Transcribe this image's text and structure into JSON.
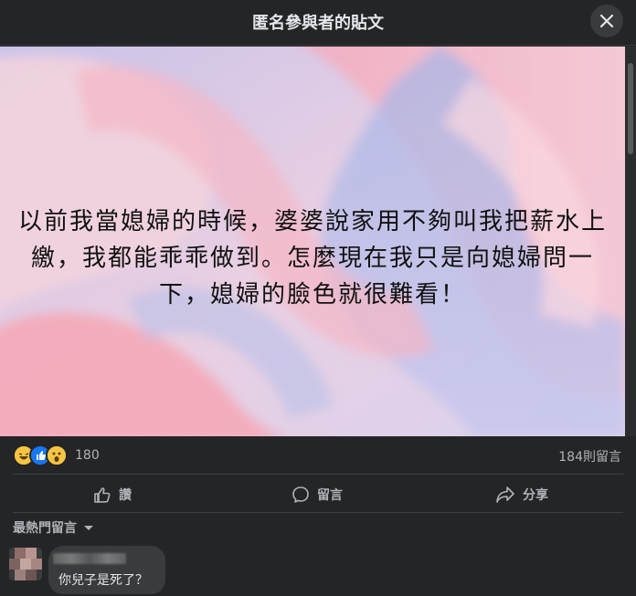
{
  "header": {
    "title": "匿名參與者的貼文",
    "close_icon": "close-icon"
  },
  "post": {
    "text": "以前我當媳婦的時候，婆婆說家用不夠叫我把薪水上繳，我都能乖乖做到。怎麼現在我只是向媳婦問一下，媳婦的臉色就很難看！",
    "background_colors": [
      "#e9b5c8",
      "#b8bde6",
      "#f2c6d3"
    ]
  },
  "reactions": {
    "icons": [
      "haha-icon",
      "like-icon",
      "wow-icon"
    ],
    "count": "180",
    "comments": "184則留言"
  },
  "actions": {
    "like": "讚",
    "comment": "留言",
    "share": "分享"
  },
  "comments_section": {
    "sort_label": "最熱門留言",
    "items": [
      {
        "author": "",
        "text": "你兒子是死了？"
      }
    ]
  }
}
